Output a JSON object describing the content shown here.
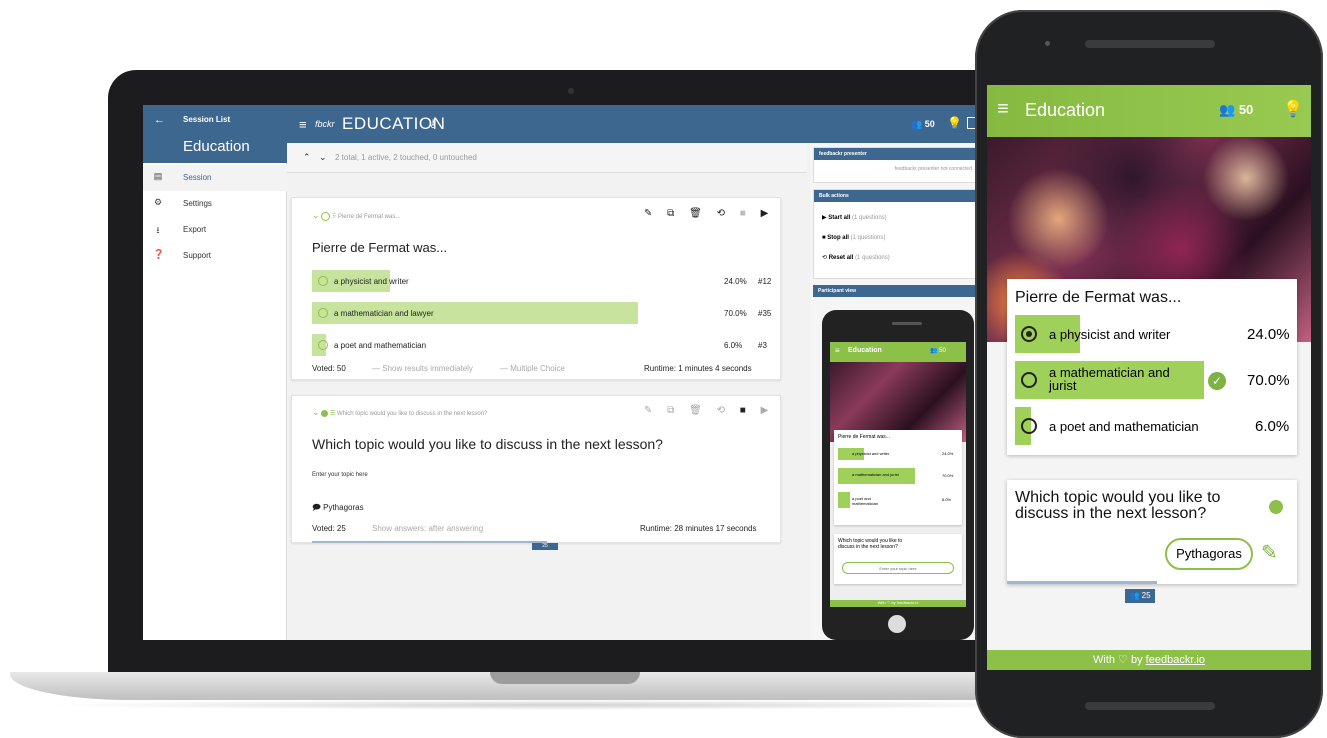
{
  "laptop": {
    "sidebar": {
      "back_icon": "arrow-left-icon",
      "session_list": "Session List",
      "title": "Education",
      "items": [
        {
          "label": "Session",
          "icon": "list-icon"
        },
        {
          "label": "Settings",
          "icon": "gear-icon"
        },
        {
          "label": "Export",
          "icon": "download-icon"
        },
        {
          "label": "Support",
          "icon": "help-icon"
        }
      ]
    },
    "header": {
      "logo": "fbckr",
      "title": "EDUCATION",
      "users": "50"
    },
    "toolbar": {
      "summary": "2 total, 1 active, 2 touched, 0 untouched"
    },
    "question1": {
      "header_text": "Pierre de Fermat was...",
      "title": "Pierre de Fermat was...",
      "options": [
        {
          "label": "a physicist and writer",
          "percent": "24.0%",
          "count": "#12",
          "share": 0.24
        },
        {
          "label": "a mathematician and lawyer",
          "percent": "70.0%",
          "count": "#35",
          "share": 0.7
        },
        {
          "label": "a poet and mathematician",
          "percent": "6.0%",
          "count": "#3",
          "share": 0.06
        }
      ],
      "voted": "Voted: 50",
      "show_results": "Show results immediately",
      "type": "Multiple Choice",
      "runtime": "Runtime: 1 minutes 4 seconds"
    },
    "question2": {
      "header_text": "Which topic would you like to discuss in the next lesson?",
      "title": "Which topic would you like to discuss in the next lesson?",
      "prompt": "Enter your topic here",
      "answer": "Pythagoras",
      "voted": "Voted: 25",
      "show_answers": "Show answers: after answering",
      "runtime": "Runtime: 28 minutes 17 seconds",
      "badge": "25"
    },
    "right_panel": {
      "presenter_header": "feedbackr presenter",
      "presenter_status": "feedbackr presenter not connected",
      "bulk_header": "Bulk actions",
      "start_all": "Start all",
      "start_all_note": "(1 questions)",
      "stop_all": "Stop all",
      "stop_all_note": "(1 questions)",
      "reset_all": "Reset all",
      "reset_all_note": "(1 questions)",
      "participant_header": "Participant view"
    }
  },
  "phone": {
    "header": {
      "title": "Education",
      "users": "50"
    },
    "question1": {
      "title": "Pierre de Fermat was...",
      "options": [
        {
          "label": "a physicist and writer",
          "percent": "24.0%",
          "share": 0.24,
          "selected": true
        },
        {
          "label": "a mathematician and jurist",
          "percent": "70.0%",
          "share": 0.7,
          "selected": false,
          "correct": true
        },
        {
          "label": "a poet and mathematician",
          "percent": "6.0%",
          "share": 0.06,
          "selected": false
        }
      ]
    },
    "question2": {
      "title": "Which topic would you like to discuss in the next lesson?",
      "answer": "Pythagoras",
      "badge": "25"
    },
    "footer": {
      "prefix": "With",
      "by": "by",
      "link": "feedbackr.io"
    }
  },
  "colors": {
    "header_blue": "#3d678f",
    "accent_green": "#8dc049",
    "bar_green": "#c8e39d"
  }
}
